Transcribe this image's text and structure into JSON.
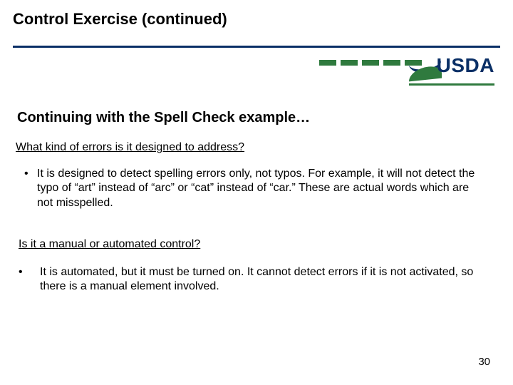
{
  "title": "Control Exercise (continued)",
  "logo_text": "USDA",
  "subtitle": "Continuing with the Spell Check example…",
  "question1": "What kind of errors is it designed to address?",
  "bullet1": "It is designed to detect spelling errors only, not typos.   For example, it will not detect the typo of “art” instead of “arc” or “cat” instead of “car.”   These are actual words which are not misspelled.",
  "question2": "Is it a manual or automated control?",
  "bullet2": "It is automated, but it must be turned on.   It cannot detect errors if it is not activated, so there is a manual element involved.",
  "page_number": "30"
}
